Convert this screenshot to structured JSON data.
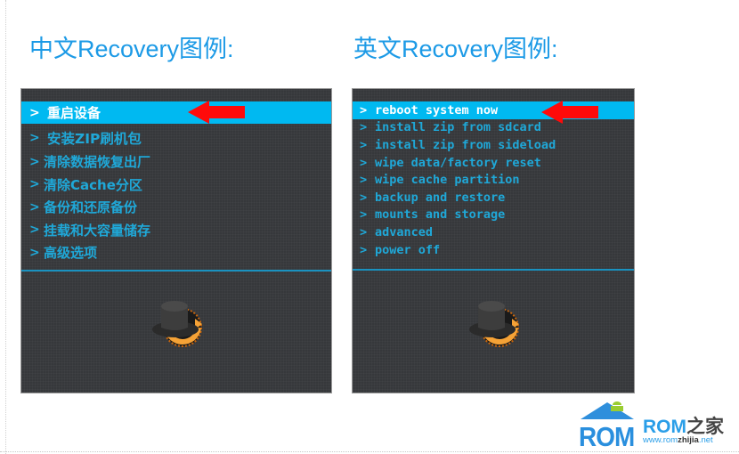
{
  "headings": {
    "chinese": "中文Recovery图例:",
    "english": "英文Recovery图例:"
  },
  "chinese_recovery": {
    "selected_index": 0,
    "chevron": ">",
    "items": [
      {
        "label": "重启设备"
      },
      {
        "label": "安装ZIP刷机包"
      },
      {
        "label": "清除数据恢复出厂"
      },
      {
        "label": "清除Cache分区"
      },
      {
        "label": "备份和还原备份"
      },
      {
        "label": "挂载和大容量储存"
      },
      {
        "label": "高级选项"
      }
    ],
    "pointer_icon": "red-left-arrow",
    "logo_icon": "clockworkmod-hat-logo"
  },
  "english_recovery": {
    "selected_index": 0,
    "chevron": ">",
    "items": [
      {
        "label": "reboot system now"
      },
      {
        "label": "install zip from sdcard"
      },
      {
        "label": "install zip from sideload"
      },
      {
        "label": "wipe data/factory reset"
      },
      {
        "label": "wipe cache partition"
      },
      {
        "label": "backup and restore"
      },
      {
        "label": "mounts and storage"
      },
      {
        "label": "advanced"
      },
      {
        "label": "power off"
      }
    ],
    "pointer_icon": "red-left-arrow",
    "logo_icon": "clockworkmod-hat-logo"
  },
  "watermark": {
    "logo_text": "ROM",
    "name_latin": "ROM",
    "name_chinese": "之家",
    "url_prefix": "www.rom",
    "url_bold": "zhijia",
    "url_suffix": ".net"
  },
  "colors": {
    "heading": "#1c9ae6",
    "panel_bg": "#36383b",
    "highlight": "#00b9f1",
    "menu_text": "#1fa8d8",
    "arrow": "#ff0000",
    "divider": "#1a92c0"
  }
}
